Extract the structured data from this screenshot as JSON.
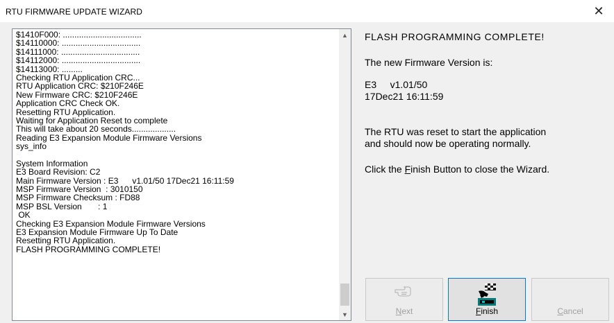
{
  "window": {
    "title": "RTU FIRMWARE UPDATE WIZARD",
    "close_glyph": "✕"
  },
  "log": {
    "lines": [
      "$1410F000: ..................................",
      "$14110000: ..................................",
      "$14111000: ..................................",
      "$14112000: ..................................",
      "$14113000: .........",
      "Checking RTU Application CRC...",
      "RTU Application CRC: $210F246E",
      "New Firmware CRC: $210F246E",
      "Application CRC Check OK.",
      "Resetting RTU Application.",
      "Waiting for Application Reset to complete",
      "This will take about 20 seconds...................",
      "Reading E3 Expansion Module Firmware Versions",
      "sys_info",
      "",
      "System Information",
      "E3 Board Revision: C2",
      "Main Firmware Version : E3      v1.01/50 17Dec21 16:11:59",
      "MSP Firmware Version  : 3010150",
      "MSP Firmware Checksum : FD88",
      "MSP BSL Version       : 1",
      " OK",
      "Checking E3 Expansion Module Firmware Versions",
      "E3 Expansion Module Firmware Up To Date",
      "Resetting RTU Application.",
      "FLASH PROGRAMMING COMPLETE!"
    ],
    "scroll_up_glyph": "▲",
    "scroll_down_glyph": "▼"
  },
  "info": {
    "heading": "FLASH PROGRAMMING COMPLETE!",
    "version_intro": "The new Firmware Version is:",
    "version_line1": "E3     v1.01/50",
    "version_line2": "17Dec21 16:11:59",
    "reset_line1": "The RTU was reset to start the application",
    "reset_line2": "and should now be operating normally.",
    "click_prefix": "Click the ",
    "click_mnemonic": "F",
    "click_suffix": "inish Button to close the Wizard."
  },
  "buttons": {
    "next": {
      "mnemonic": "N",
      "rest": "ext",
      "icon": "pointing-hand-icon",
      "enabled": false
    },
    "finish": {
      "mnemonic": "F",
      "rest": "inish",
      "icon": "finish-flag-icon",
      "enabled": true
    },
    "cancel": {
      "mnemonic": "C",
      "rest": "ancel",
      "enabled": false
    }
  }
}
